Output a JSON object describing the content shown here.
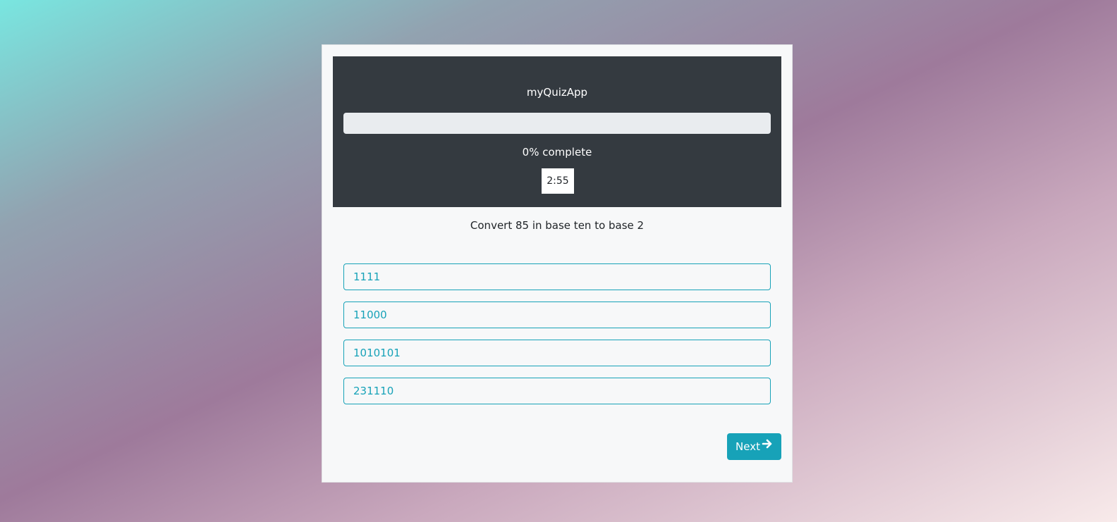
{
  "app": {
    "title": "myQuizApp"
  },
  "progress": {
    "percent": 0,
    "label": "0% complete"
  },
  "timer": {
    "value": "2:55"
  },
  "question": {
    "text": "Convert 85 in base ten to base 2"
  },
  "answers": [
    {
      "label": "1111"
    },
    {
      "label": "11000"
    },
    {
      "label": "1010101"
    },
    {
      "label": "231110"
    }
  ],
  "navigation": {
    "next_label": "Next",
    "next_icon": "arrow-right-icon"
  },
  "colors": {
    "accent": "#17a2b8",
    "header_bg": "#343a40",
    "card_bg": "#f7f8f9",
    "progress_track": "#e9ecef"
  }
}
